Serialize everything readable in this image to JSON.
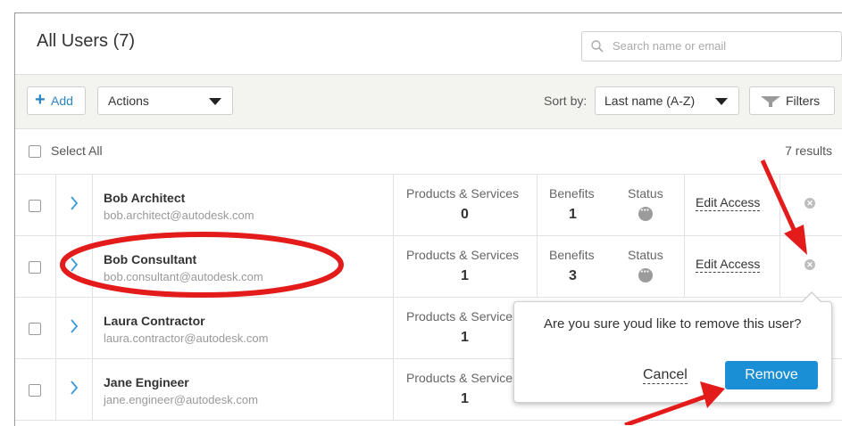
{
  "header": {
    "title": "All Users (7)",
    "search_placeholder": "Search name or email"
  },
  "toolbar": {
    "add_label": "Add",
    "actions_label": "Actions",
    "sort_label": "Sort by:",
    "sort_value": "Last name (A-Z)",
    "filters_label": "Filters"
  },
  "selectbar": {
    "select_all_label": "Select All",
    "results_text": "7 results"
  },
  "columns": {
    "products_label": "Products & Services",
    "products_label_truncated": "Products & Service",
    "benefits_label": "Benefits",
    "status_label": "Status",
    "edit_access_label": "Edit Access"
  },
  "users": [
    {
      "name": "Bob Architect",
      "email": "bob.architect@autodesk.com",
      "products": "0",
      "benefits": "1"
    },
    {
      "name": "Bob Consultant",
      "email": "bob.consultant@autodesk.com",
      "products": "1",
      "benefits": "3"
    },
    {
      "name": "Laura Contractor",
      "email": "laura.contractor@autodesk.com",
      "products": "1",
      "benefits": ""
    },
    {
      "name": "Jane Engineer",
      "email": "jane.engineer@autodesk.com",
      "products": "1",
      "benefits": ""
    }
  ],
  "confirm": {
    "message": "Are you sure youd like to remove this user?",
    "cancel_label": "Cancel",
    "remove_label": "Remove"
  },
  "colors": {
    "accent": "#1a8fd6",
    "annotation": "#e31b1b",
    "toolbar_bg": "#f3f3ef"
  },
  "icons": {
    "search": "search-icon",
    "chevron": "chevron-right-icon",
    "status": "status-more-icon",
    "remove": "remove-x-icon",
    "filter": "funnel-icon"
  }
}
